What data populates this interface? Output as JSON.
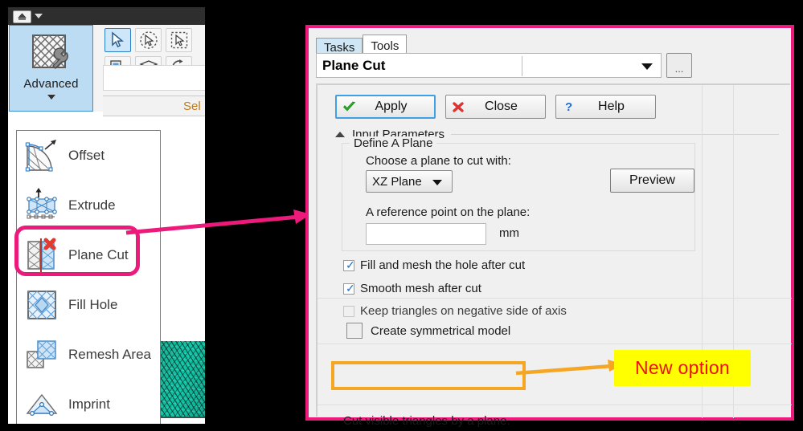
{
  "app": {
    "titlebar": {
      "menu_button_icon": "app-button-icon",
      "dropdown_icon": "chevron-down-icon"
    },
    "ribbon": {
      "advanced_button": {
        "label": "Advanced",
        "icon": "mesh-wrench-icon",
        "caret_icon": "chevron-down-icon"
      },
      "tools": [
        {
          "name": "select-arrow-tool",
          "icon": "cursor-arrow-icon",
          "selected": true
        },
        {
          "name": "circle-select-tool",
          "icon": "circle-lasso-cursor-icon",
          "selected": false
        },
        {
          "name": "rectangle-select-tool",
          "icon": "rect-lasso-cursor-icon",
          "selected": false
        },
        {
          "name": "surface-select-tool",
          "icon": "surface-cursor-icon",
          "selected": false
        },
        {
          "name": "layer-select-tool",
          "icon": "layers-icon",
          "selected": false
        },
        {
          "name": "through-select-tool",
          "icon": "through-cursor-icon",
          "selected": false
        }
      ],
      "selection_label": "Sel"
    },
    "viewport": {
      "mesh_name": "teal-triangle-mesh"
    }
  },
  "flyout_menu": {
    "items": [
      {
        "label": "Offset",
        "icon": "offset-mesh-icon"
      },
      {
        "label": "Extrude",
        "icon": "extrude-mesh-icon"
      },
      {
        "label": "Plane Cut",
        "icon": "plane-cut-icon",
        "highlighted": true
      },
      {
        "label": "Fill Hole",
        "icon": "fill-hole-icon"
      },
      {
        "label": "Remesh Area",
        "icon": "remesh-area-icon"
      },
      {
        "label": "Imprint",
        "icon": "imprint-icon"
      }
    ]
  },
  "dialog": {
    "tabs": [
      {
        "label": "Tasks",
        "active": false
      },
      {
        "label": "Tools",
        "active": true
      }
    ],
    "title": "Plane Cut",
    "dropdown_value": "",
    "dropdown_caret_icon": "chevron-down-icon",
    "ellipsis_button_label": "...",
    "buttons": [
      {
        "label": "Apply",
        "icon": "green-check-icon",
        "focused": true
      },
      {
        "label": "Close",
        "icon": "red-x-icon",
        "focused": false
      },
      {
        "label": "Help",
        "icon": "blue-question-icon",
        "focused": false
      }
    ],
    "section": {
      "title": "Input Parameters",
      "collapse_icon": "chevron-up-icon"
    },
    "group": {
      "legend": "Define A Plane",
      "plane_label": "Choose a plane to cut with:",
      "plane_value": "XZ Plane",
      "preview_label": "Preview",
      "reference_label": "A reference point on the plane:",
      "reference_value": "",
      "reference_unit": "mm"
    },
    "checkboxes": [
      {
        "label": "Fill and mesh the hole after cut",
        "checked": true,
        "style": "normal"
      },
      {
        "label": "Smooth mesh after cut",
        "checked": true,
        "style": "normal"
      },
      {
        "label": "Keep triangles on negative side of axis",
        "checked": false,
        "style": "dim"
      },
      {
        "label": "Create symmetrical model",
        "checked": false,
        "style": "big"
      }
    ],
    "status_text": "Cut visible triangles by a plane."
  },
  "annotations": {
    "new_option_label": "New option",
    "highlight_color": "#ec1a7b",
    "callout_color": "#f5a623",
    "callout_bg": "#ffff00",
    "callout_text_color": "#ee1111"
  }
}
